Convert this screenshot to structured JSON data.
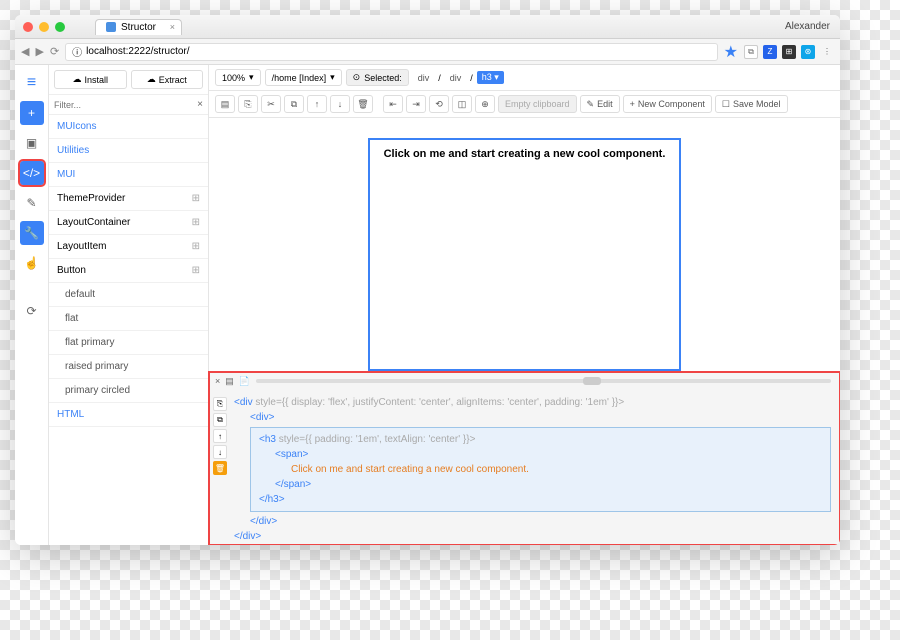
{
  "browser": {
    "tab_title": "Structor",
    "user": "Alexander",
    "url": "localhost:2222/structor/"
  },
  "sidebar": {
    "install": "Install",
    "extract": "Extract",
    "filter_placeholder": "Filter...",
    "items": [
      {
        "label": "MUIcons",
        "type": "cat"
      },
      {
        "label": "Utilities",
        "type": "cat"
      },
      {
        "label": "MUI",
        "type": "cat"
      },
      {
        "label": "ThemeProvider",
        "type": "node",
        "icon": "+"
      },
      {
        "label": "LayoutContainer",
        "type": "node",
        "icon": "+"
      },
      {
        "label": "LayoutItem",
        "type": "node",
        "icon": "+"
      },
      {
        "label": "Button",
        "type": "node",
        "icon": "−"
      },
      {
        "label": "default",
        "type": "sub"
      },
      {
        "label": "flat",
        "type": "sub"
      },
      {
        "label": "flat primary",
        "type": "sub"
      },
      {
        "label": "raised primary",
        "type": "sub"
      },
      {
        "label": "primary circled",
        "type": "sub"
      },
      {
        "label": "HTML",
        "type": "cat"
      }
    ]
  },
  "toolbar": {
    "zoom": "100%",
    "page": "/home [Index]",
    "selected_label": "Selected:",
    "breadcrumb": [
      "div",
      "div",
      "h3"
    ],
    "empty_clipboard": "Empty clipboard",
    "edit": "Edit",
    "new_component": "New Component",
    "save_model": "Save Model"
  },
  "canvas": {
    "preview_text": "Click on me and start creating a new cool component."
  },
  "code": {
    "l1_tag": "<div",
    "l1_style": " style={{ display: 'flex', justifyContent: 'center', alignItems: 'center', padding: '1em' }}>",
    "l2": "<div>",
    "l3_tag": "<h3",
    "l3_style": " style={{ padding: '1em', textAlign: 'center' }}>",
    "l4": "<span>",
    "l5": "Click on me and start creating a new cool component.",
    "l6": "</span>",
    "l7": "</h3>",
    "l8": "</div>",
    "l9": "</div>"
  }
}
